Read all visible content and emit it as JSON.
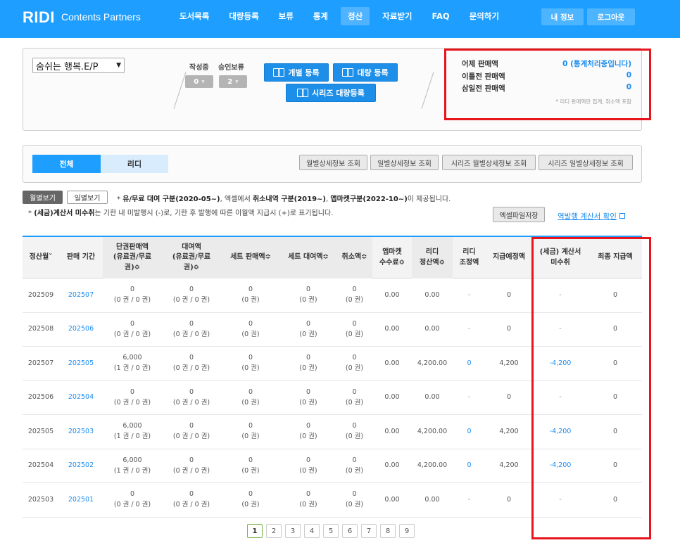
{
  "header": {
    "logo": "RIDI",
    "logo_sub": "Contents Partners",
    "nav": [
      "도서목록",
      "대량등록",
      "보류",
      "통계",
      "정산",
      "자료받기",
      "FAQ",
      "문의하기"
    ],
    "active_nav": "정산",
    "my_info": "내 정보",
    "logout": "로그아웃",
    "brand_color": "#1e9eff"
  },
  "summary": {
    "book_select_value": "숨쉬는 행복.E/P",
    "writing_label": "작성중",
    "writing_count": "0",
    "hold_label": "승인보류",
    "hold_count": "2",
    "single_register": "개별 등록",
    "bulk_register": "대량 등록",
    "series_bulk_register": "시리즈 대량등록",
    "sales": [
      {
        "label": "어제 판매액",
        "value": "0 (통계처리중입니다)"
      },
      {
        "label": "이틀전 판매액",
        "value": "0"
      },
      {
        "label": "삼일전 판매액",
        "value": "0"
      }
    ],
    "sales_note": "* 리디 판매액만 집계, 취소액 포함"
  },
  "tabs": {
    "all": "전체",
    "ridi": "리디",
    "detail_buttons": [
      "월별상세정보 조회",
      "일별상세정보 조회",
      "시리즈 월별상세정보 조회",
      "시리즈 일별상세정보 조회"
    ]
  },
  "notes": {
    "monthly_view": "월별보기",
    "daily_view": "일별보기",
    "note1_prefix": "* ",
    "note1_b1": "유/무료 대여 구분(2020-05~)",
    "note1_m1": ", 엑셀에서 ",
    "note1_b2": "취소내역 구분(2019~)",
    "note1_m2": ", ",
    "note1_b3": "앱마켓구분(2022-10~)",
    "note1_end": "이 제공됩니다.",
    "note2_prefix": "* ",
    "note2_b": "(세금)계산서 미수취",
    "note2_end": "는 기한 내 미발행시 (-)로, 기한 후 발행에 따른 이월액 지급시 (+)로 표기됩니다.",
    "excel_save": "엑셀파일저장",
    "invoice_link": "역발행 계산서 확인"
  },
  "table": {
    "headers": [
      "정산월ˇ",
      "판매 기간",
      "단권판매액\n(유료권/무료\n권)≎",
      "대여액\n(유료권/무료\n권)≎",
      "세트 판매액≎",
      "세트 대여액≎",
      "취소액≎",
      "앱마켓\n수수료≎",
      "리디\n정산액≎",
      "리디\n조정액",
      "지급예정액",
      "(세금) 계산서\n미수취",
      "최종 지급액"
    ],
    "rows": [
      {
        "month": "202509",
        "period": "202507",
        "single": "0",
        "single_sub": "(0 권 / 0 권)",
        "rent": "0",
        "rent_sub": "(0 권 / 0 권)",
        "set_sale": "0",
        "set_sale_sub": "(0 권)",
        "set_rent": "0",
        "set_rent_sub": "(0 권)",
        "cancel": "0",
        "cancel_sub": "(0 권)",
        "fee": "0.00",
        "ridi": "0.00",
        "adjust": "-",
        "expected": "0",
        "unreceived": "-",
        "final": "0"
      },
      {
        "month": "202508",
        "period": "202506",
        "single": "0",
        "single_sub": "(0 권 / 0 권)",
        "rent": "0",
        "rent_sub": "(0 권 / 0 권)",
        "set_sale": "0",
        "set_sale_sub": "(0 권)",
        "set_rent": "0",
        "set_rent_sub": "(0 권)",
        "cancel": "0",
        "cancel_sub": "(0 권)",
        "fee": "0.00",
        "ridi": "0.00",
        "adjust": "-",
        "expected": "0",
        "unreceived": "-",
        "final": "0"
      },
      {
        "month": "202507",
        "period": "202505",
        "single": "6,000",
        "single_sub": "(1 권 / 0 권)",
        "rent": "0",
        "rent_sub": "(0 권 / 0 권)",
        "set_sale": "0",
        "set_sale_sub": "(0 권)",
        "set_rent": "0",
        "set_rent_sub": "(0 권)",
        "cancel": "0",
        "cancel_sub": "(0 권)",
        "fee": "0.00",
        "ridi": "4,200.00",
        "adjust": "0",
        "expected": "4,200",
        "unreceived": "-4,200",
        "final": "0"
      },
      {
        "month": "202506",
        "period": "202504",
        "single": "0",
        "single_sub": "(0 권 / 0 권)",
        "rent": "0",
        "rent_sub": "(0 권 / 0 권)",
        "set_sale": "0",
        "set_sale_sub": "(0 권)",
        "set_rent": "0",
        "set_rent_sub": "(0 권)",
        "cancel": "0",
        "cancel_sub": "(0 권)",
        "fee": "0.00",
        "ridi": "0.00",
        "adjust": "-",
        "expected": "0",
        "unreceived": "-",
        "final": "0"
      },
      {
        "month": "202505",
        "period": "202503",
        "single": "6,000",
        "single_sub": "(1 권 / 0 권)",
        "rent": "0",
        "rent_sub": "(0 권 / 0 권)",
        "set_sale": "0",
        "set_sale_sub": "(0 권)",
        "set_rent": "0",
        "set_rent_sub": "(0 권)",
        "cancel": "0",
        "cancel_sub": "(0 권)",
        "fee": "0.00",
        "ridi": "4,200.00",
        "adjust": "0",
        "expected": "4,200",
        "unreceived": "-4,200",
        "final": "0"
      },
      {
        "month": "202504",
        "period": "202502",
        "single": "6,000",
        "single_sub": "(1 권 / 0 권)",
        "rent": "0",
        "rent_sub": "(0 권 / 0 권)",
        "set_sale": "0",
        "set_sale_sub": "(0 권)",
        "set_rent": "0",
        "set_rent_sub": "(0 권)",
        "cancel": "0",
        "cancel_sub": "(0 권)",
        "fee": "0.00",
        "ridi": "4,200.00",
        "adjust": "0",
        "expected": "4,200",
        "unreceived": "-4,200",
        "final": "0"
      },
      {
        "month": "202503",
        "period": "202501",
        "single": "0",
        "single_sub": "(0 권 / 0 권)",
        "rent": "0",
        "rent_sub": "(0 권 / 0 권)",
        "set_sale": "0",
        "set_sale_sub": "(0 권)",
        "set_rent": "0",
        "set_rent_sub": "(0 권)",
        "cancel": "0",
        "cancel_sub": "(0 권)",
        "fee": "0.00",
        "ridi": "0.00",
        "adjust": "-",
        "expected": "0",
        "unreceived": "-",
        "final": "0"
      }
    ]
  },
  "pagination": {
    "pages": [
      "1",
      "2",
      "3",
      "4",
      "5",
      "6",
      "7",
      "8",
      "9"
    ],
    "current": "1"
  },
  "highlight_color": "#e8141b"
}
